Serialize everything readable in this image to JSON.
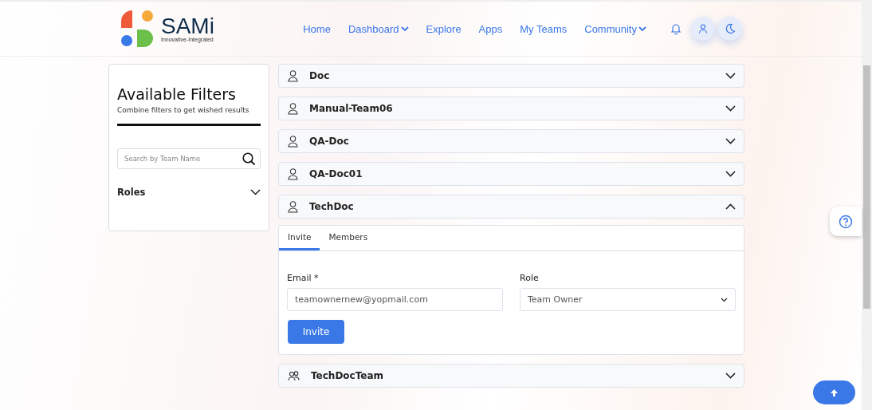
{
  "header": {
    "logo": {
      "name": "SAMi",
      "tagline": "Innovative-Integrated"
    },
    "nav": [
      {
        "label": "Home",
        "dropdown": false
      },
      {
        "label": "Dashboard",
        "dropdown": true
      },
      {
        "label": "Explore",
        "dropdown": false
      },
      {
        "label": "Apps",
        "dropdown": false
      },
      {
        "label": "My Teams",
        "dropdown": false
      },
      {
        "label": "Community",
        "dropdown": true
      }
    ]
  },
  "filters": {
    "title": "Available Filters",
    "subtitle": "Combine filters to get wished results",
    "search": {
      "placeholder": "Search by Team Name"
    },
    "sections": [
      {
        "label": "Roles",
        "expanded": false
      }
    ]
  },
  "teams": [
    {
      "name": "Doc",
      "kind": "person",
      "expanded": false
    },
    {
      "name": "Manual-Team06",
      "kind": "person",
      "expanded": false
    },
    {
      "name": "QA-Doc",
      "kind": "person",
      "expanded": false
    },
    {
      "name": "QA-Doc01",
      "kind": "person",
      "expanded": false
    },
    {
      "name": "TechDoc",
      "kind": "person",
      "expanded": true,
      "tabs": [
        {
          "label": "Invite",
          "selected": true
        },
        {
          "label": "Members",
          "selected": false
        }
      ],
      "form": {
        "email_label": "Email *",
        "email_value": "teamownernew@yopmail.com",
        "role_label": "Role",
        "role_value": "Team Owner",
        "submit": "Invite"
      }
    },
    {
      "name": "TechDocTeam",
      "kind": "group",
      "expanded": false
    }
  ]
}
